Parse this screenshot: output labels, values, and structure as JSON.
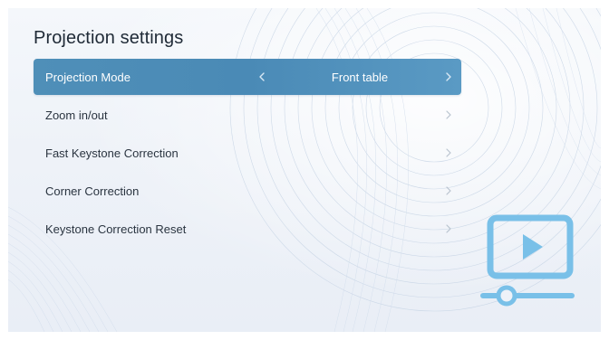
{
  "page": {
    "title": "Projection settings"
  },
  "menu": {
    "items": [
      {
        "label": "Projection Mode",
        "value": "Front table",
        "selected": true
      },
      {
        "label": "Zoom in/out",
        "selected": false
      },
      {
        "label": "Fast Keystone Correction",
        "selected": false
      },
      {
        "label": "Corner Correction",
        "selected": false
      },
      {
        "label": "Keystone Correction Reset",
        "selected": false
      }
    ]
  },
  "icons": {
    "left": "chevron-left-icon",
    "right": "chevron-right-icon",
    "decor": "projector-play-icon"
  },
  "colors": {
    "selected_row": "#4a8ab6",
    "accent_icon": "#79c0e8",
    "background": "#eef2f8",
    "text": "#2a3440"
  }
}
